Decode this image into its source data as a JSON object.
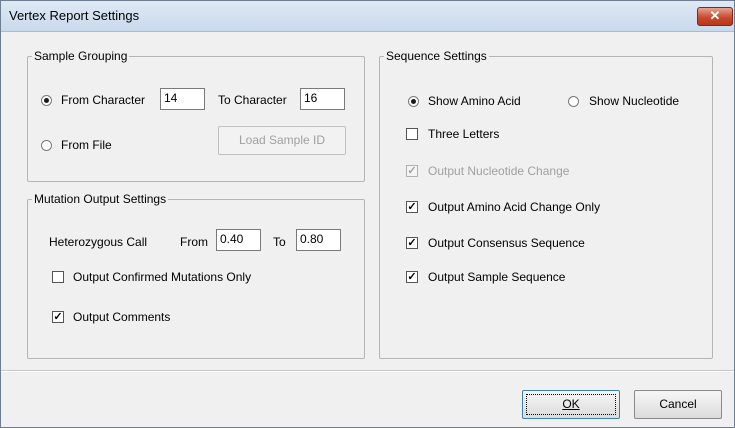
{
  "window": {
    "title": "Vertex Report Settings",
    "close_glyph": "✕"
  },
  "sample_grouping": {
    "legend": "Sample Grouping",
    "from_character_label": "From Character",
    "from_character_value": "14",
    "to_character_label": "To Character",
    "to_character_value": "16",
    "from_file_label": "From File",
    "load_sample_id_label": "Load Sample ID",
    "selected": "From Character"
  },
  "mutation_output": {
    "legend": "Mutation Output Settings",
    "heterozygous_label": "Heterozygous Call",
    "from_label": "From",
    "from_value": "0.40",
    "to_label": "To",
    "to_value": "0.80",
    "confirmed_only_label": "Output Confirmed Mutations Only",
    "confirmed_only_checked": false,
    "comments_label": "Output Comments",
    "comments_checked": true
  },
  "sequence_settings": {
    "legend": "Sequence Settings",
    "show_amino_acid_label": "Show Amino Acid",
    "show_nucleotide_label": "Show Nucleotide",
    "selected": "Show Amino Acid",
    "three_letters_label": "Three Letters",
    "three_letters_checked": false,
    "nucleotide_change_label": "Output Nucleotide Change",
    "nucleotide_change_checked": true,
    "amino_acid_change_label": "Output Amino Acid Change Only",
    "amino_acid_change_checked": true,
    "consensus_label": "Output Consensus Sequence",
    "consensus_checked": true,
    "sample_sequence_label": "Output Sample Sequence",
    "sample_sequence_checked": true
  },
  "buttons": {
    "ok": "OK",
    "cancel": "Cancel"
  },
  "check_glyph": "✓"
}
